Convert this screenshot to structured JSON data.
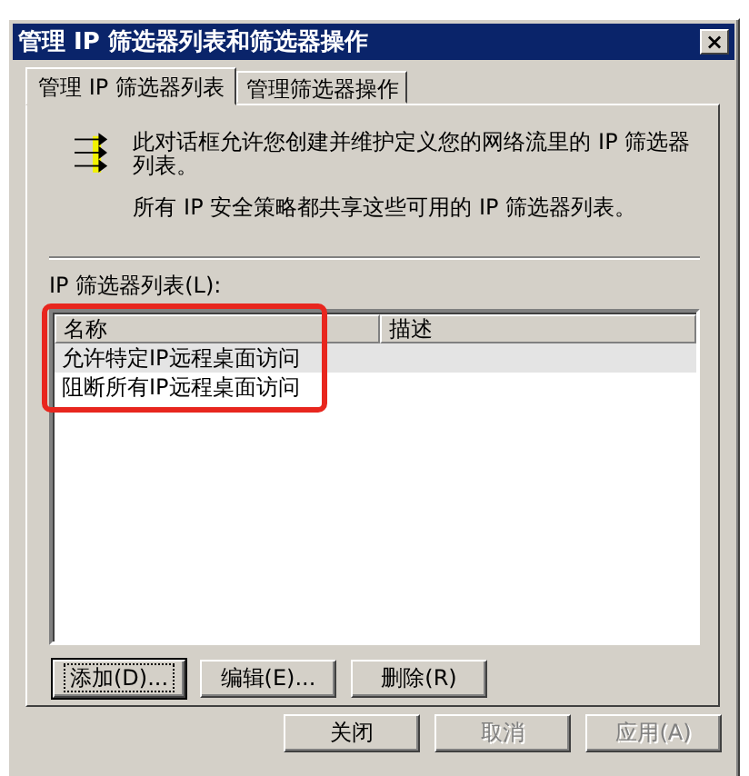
{
  "window": {
    "title": "管理 IP 筛选器列表和筛选器操作",
    "close": "×"
  },
  "tabs": [
    {
      "label": "管理 IP 筛选器列表",
      "selected": true
    },
    {
      "label": "管理筛选器操作",
      "selected": false
    }
  ],
  "intro": [
    "此对话框允许您创建并维护定义您的网络流里的 IP 筛选器列表。",
    "所有 IP 安全策略都共享这些可用的 IP 筛选器列表。"
  ],
  "list": {
    "label": "IP 筛选器列表(L):",
    "columns": [
      "名称",
      "描述"
    ],
    "rows": [
      {
        "name": "允许特定IP远程桌面访问",
        "selected": true
      },
      {
        "name": "阻断所有IP远程桌面访问",
        "selected": false
      }
    ],
    "annotation": {
      "kind": "outline",
      "color": "#e8261e"
    }
  },
  "list_buttons": [
    {
      "label": "添加(D)...",
      "focused": true,
      "disabled": false
    },
    {
      "label": "编辑(E)...",
      "focused": false,
      "disabled": false
    },
    {
      "label": "删除(R)",
      "focused": false,
      "disabled": false
    }
  ],
  "dialog_buttons": [
    {
      "label": "关闭",
      "disabled": false
    },
    {
      "label": "取消",
      "disabled": true
    },
    {
      "label": "应用(A)",
      "disabled": true
    }
  ]
}
